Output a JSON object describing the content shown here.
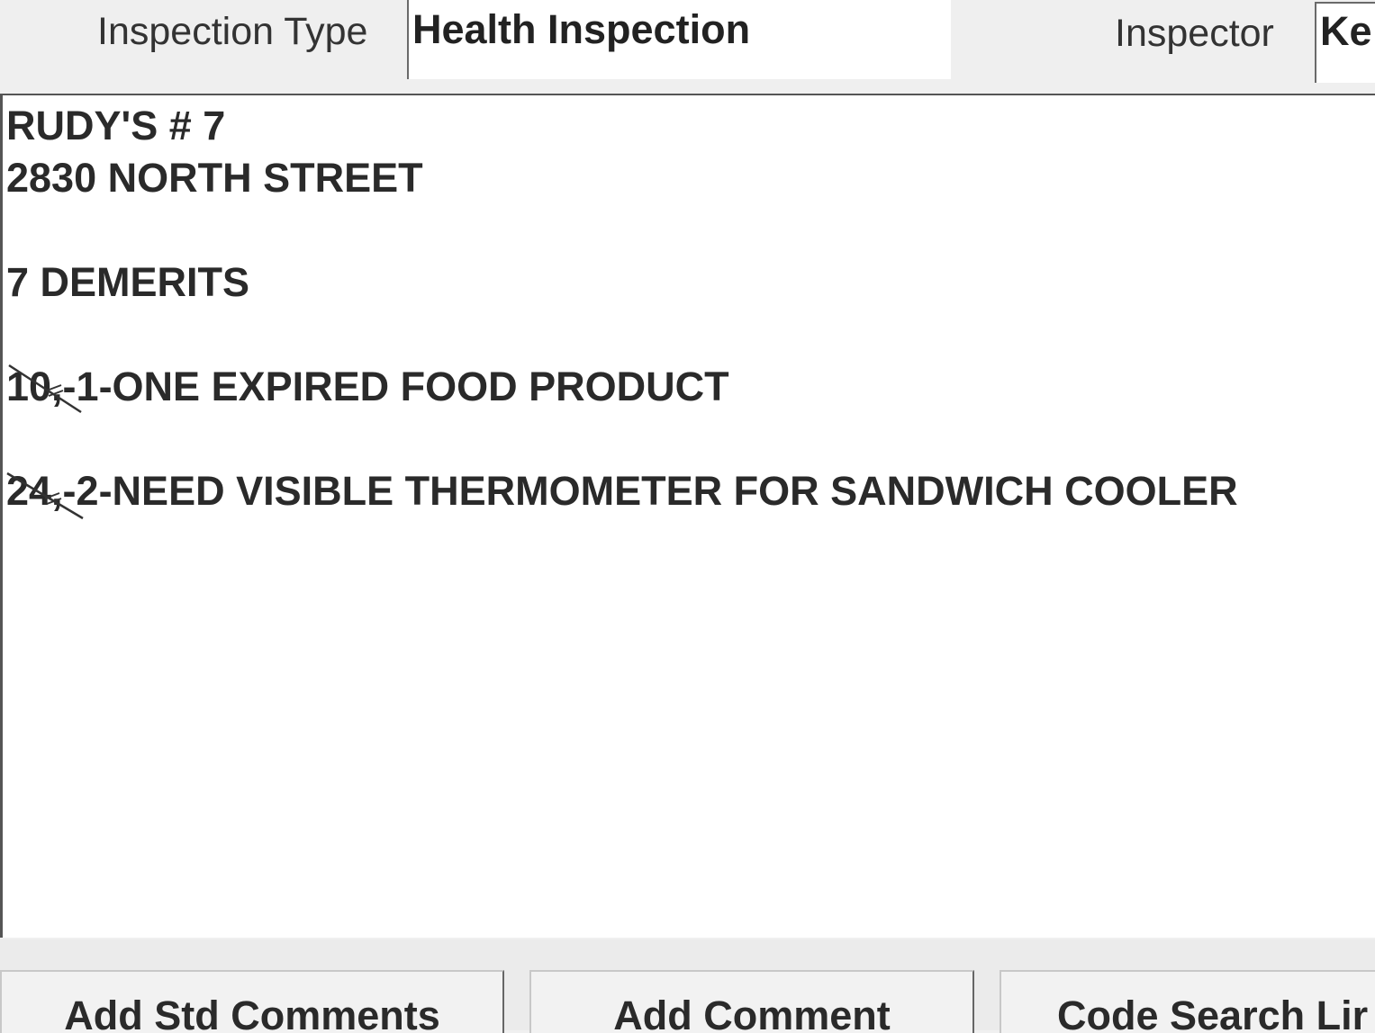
{
  "header": {
    "inspection_type_label": "Inspection Type",
    "inspection_type_value": "Health Inspection",
    "inspector_label": "Inspector",
    "inspector_value": "Ke"
  },
  "comments": {
    "lines": [
      "RUDY'S # 7",
      "2830 NORTH STREET",
      "7 DEMERITS",
      "10,-1-ONE EXPIRED FOOD PRODUCT",
      "24,-2-NEED VISIBLE THERMOMETER FOR SANDWICH COOLER"
    ]
  },
  "buttons": {
    "add_std_comments": {
      "pre": "Add ",
      "accel": "S",
      "post": "td Comments"
    },
    "add_comment": {
      "pre": "",
      "accel": "A",
      "post": "dd Comment"
    },
    "code_search": {
      "label": "Code Search Lir"
    }
  }
}
